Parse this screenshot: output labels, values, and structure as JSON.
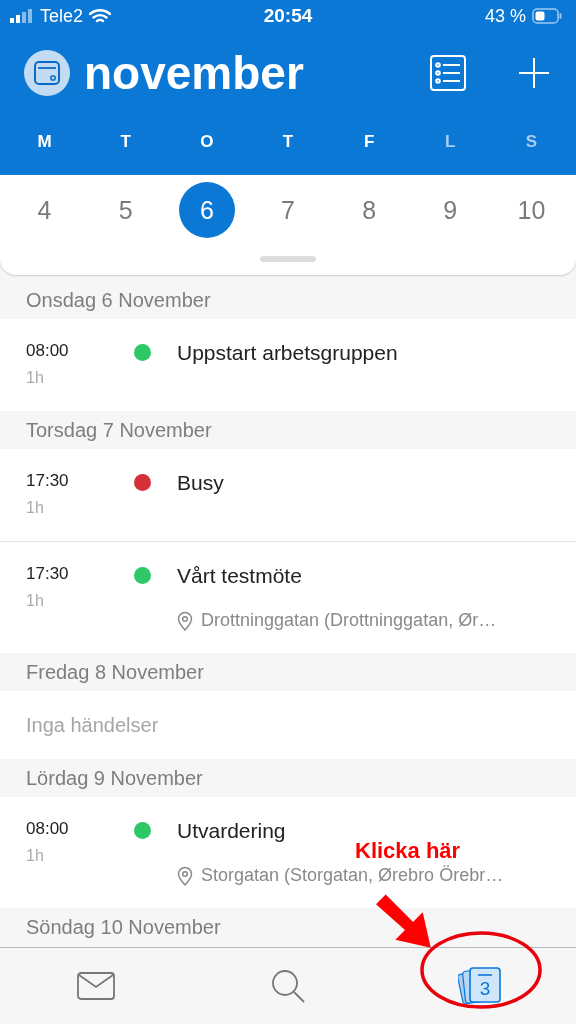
{
  "status_bar": {
    "carrier": "Tele2",
    "time": "20:54",
    "battery": "43 %"
  },
  "header": {
    "title": "november"
  },
  "weekdays": [
    {
      "label": "M",
      "dimmed": false
    },
    {
      "label": "T",
      "dimmed": false
    },
    {
      "label": "O",
      "dimmed": false
    },
    {
      "label": "T",
      "dimmed": false
    },
    {
      "label": "F",
      "dimmed": false
    },
    {
      "label": "L",
      "dimmed": true
    },
    {
      "label": "S",
      "dimmed": true
    }
  ],
  "dates": [
    {
      "label": "4",
      "selected": false
    },
    {
      "label": "5",
      "selected": false
    },
    {
      "label": "6",
      "selected": true
    },
    {
      "label": "7",
      "selected": false
    },
    {
      "label": "8",
      "selected": false
    },
    {
      "label": "9",
      "selected": false
    },
    {
      "label": "10",
      "selected": false
    }
  ],
  "sections": [
    {
      "date": "Onsdag 6 November",
      "events": [
        {
          "time": "08:00",
          "duration": "1h",
          "title": "Uppstart arbetsgruppen",
          "color": "#2ec866"
        }
      ]
    },
    {
      "date": "Torsdag 7 November",
      "events": [
        {
          "time": "17:30",
          "duration": "1h",
          "title": "Busy",
          "color": "#d3303a"
        },
        {
          "time": "17:30",
          "duration": "1h",
          "title": "Vårt testmöte",
          "color": "#2ec866",
          "location": "Drottninggatan (Drottninggatan, Ør…"
        }
      ]
    },
    {
      "date": "Fredag 8 November",
      "note": "Inga händelser"
    },
    {
      "date": "Lördag 9 November",
      "events": [
        {
          "time": "08:00",
          "duration": "1h",
          "title": "Utvardering",
          "color": "#2ec866",
          "location": "Storgatan (Storgatan, Ørebro Örebr…"
        }
      ]
    },
    {
      "date": "Söndag 10 November"
    }
  ],
  "tabs": [
    {
      "kind": "mail",
      "selected": false
    },
    {
      "kind": "search",
      "selected": false
    },
    {
      "kind": "calendar",
      "selected": true,
      "badge": "3"
    }
  ],
  "annotation": {
    "text": "Klicka här"
  }
}
